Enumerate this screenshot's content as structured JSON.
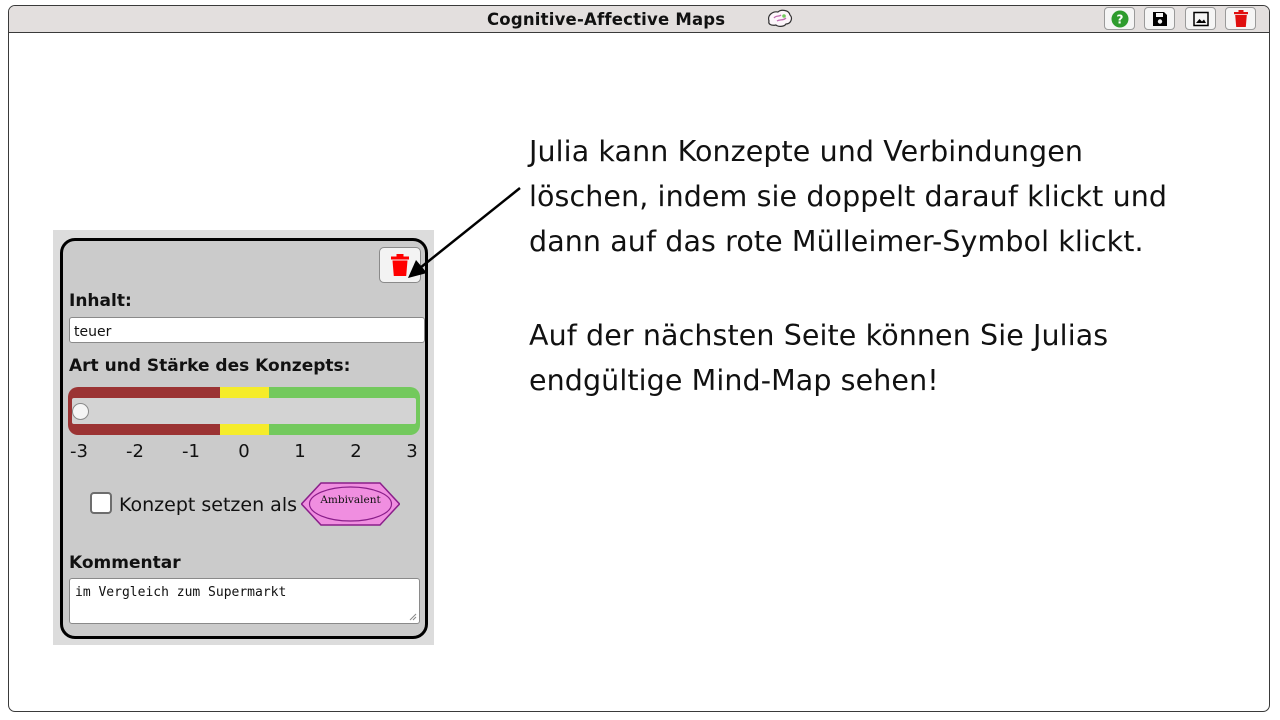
{
  "app": {
    "title": "Cognitive-Affective Maps",
    "icons": [
      "brain-icon"
    ],
    "toolbar": [
      {
        "name": "help-icon",
        "color": "#2e9c2e"
      },
      {
        "name": "save-icon",
        "color": "#000000"
      },
      {
        "name": "image-icon",
        "color": "#000000"
      },
      {
        "name": "trash-icon",
        "color": "#e01010"
      }
    ]
  },
  "editor": {
    "delete_icon": "trash-icon",
    "delete_color": "#ff0000",
    "content_label": "Inhalt:",
    "content_value": "teuer",
    "type_label": "Art und Stärke des Konzepts:",
    "slider": {
      "min": -3,
      "max": 3,
      "value": -3,
      "ticks": [
        "-3",
        "-2",
        "-1",
        "0",
        "1",
        "2",
        "3"
      ],
      "colors": {
        "negative": "#9b3333",
        "neutral": "#f5ec2a",
        "positive": "#73c95d"
      }
    },
    "checkbox_label": "Konzept setzen als",
    "checkbox_checked": false,
    "ambivalent_label": "Ambivalent",
    "ambivalent_color": "#f08ee0",
    "comment_label": "Kommentar",
    "comment_value": "im Vergleich zum Supermarkt"
  },
  "instructions": {
    "lines1": [
      "Julia kann Konzepte und Verbindungen",
      "löschen, indem sie doppelt darauf klickt und",
      "dann auf das rote Mülleimer-Symbol klickt."
    ],
    "lines2": [
      "Auf der nächsten Seite können Sie Julias",
      "endgültige Mind-Map sehen!"
    ]
  }
}
